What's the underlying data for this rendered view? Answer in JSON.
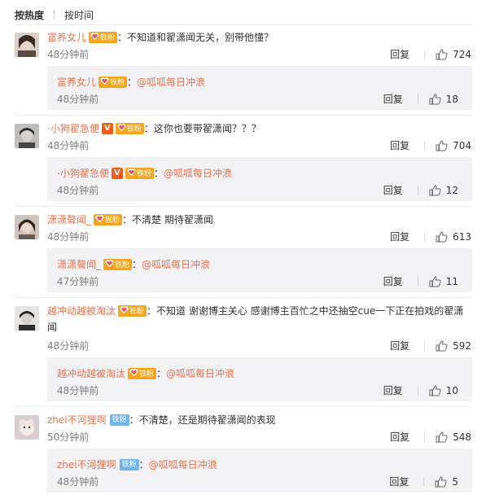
{
  "sort": {
    "hot": "按热度",
    "time": "按时间"
  },
  "colors": {
    "accent": "#eb7350",
    "fan_badge": "#f7a51c",
    "blue_badge": "#6fb5f0",
    "v_badge": "#f25c19"
  },
  "badges": {
    "fan": "铁粉",
    "v": "V"
  },
  "actions": {
    "reply": "回复"
  },
  "comments": [
    {
      "user": "富养女儿",
      "text": "：不知道和翟潇闻无关，别带他懂？",
      "time": "48分钟前",
      "likes": "724",
      "reply": {
        "user": "富养女儿",
        "text": "：",
        "mention": "@呱呱每日冲浪",
        "time": "48分钟前",
        "likes": "18"
      }
    },
    {
      "user": "·小狗翟急便",
      "text": "：这你也要带翟潇闻？？？",
      "time": "48分钟前",
      "likes": "704",
      "reply": {
        "user": "·小狗翟急便",
        "text": "：",
        "mention": "@呱呱每日冲浪",
        "time": "48分钟前",
        "likes": "12"
      }
    },
    {
      "user": "潇潇聱闻_",
      "text": "：不清楚 期待翟潇闻",
      "time": "48分钟前",
      "likes": "613",
      "reply": {
        "user": "潇潇聱闻_",
        "text": "：",
        "mention": "@呱呱每日冲浪",
        "time": "47分钟前",
        "likes": "11"
      }
    },
    {
      "user": "越冲动越被淘汰",
      "text_line1": "：不知道 谢谢博主关心 感谢博主百忙之中还抽空cue一下正在拍戏的翟潇",
      "text_line2": "闻",
      "time": "48分钟前",
      "likes": "592",
      "reply": {
        "user": "越冲动越被淘汰",
        "text": "：",
        "mention": "@呱呱每日冲浪",
        "time": "48分钟前",
        "likes": "10"
      }
    },
    {
      "user": "zhei不河狸啊",
      "text": "：不清楚，还是期待翟潇闻的表现",
      "time": "50分钟前",
      "likes": "548",
      "reply": {
        "user": "zhei不河狸啊",
        "text": "：",
        "mention": "@呱呱每日冲浪",
        "time": "48分钟前",
        "likes": "5"
      }
    }
  ]
}
